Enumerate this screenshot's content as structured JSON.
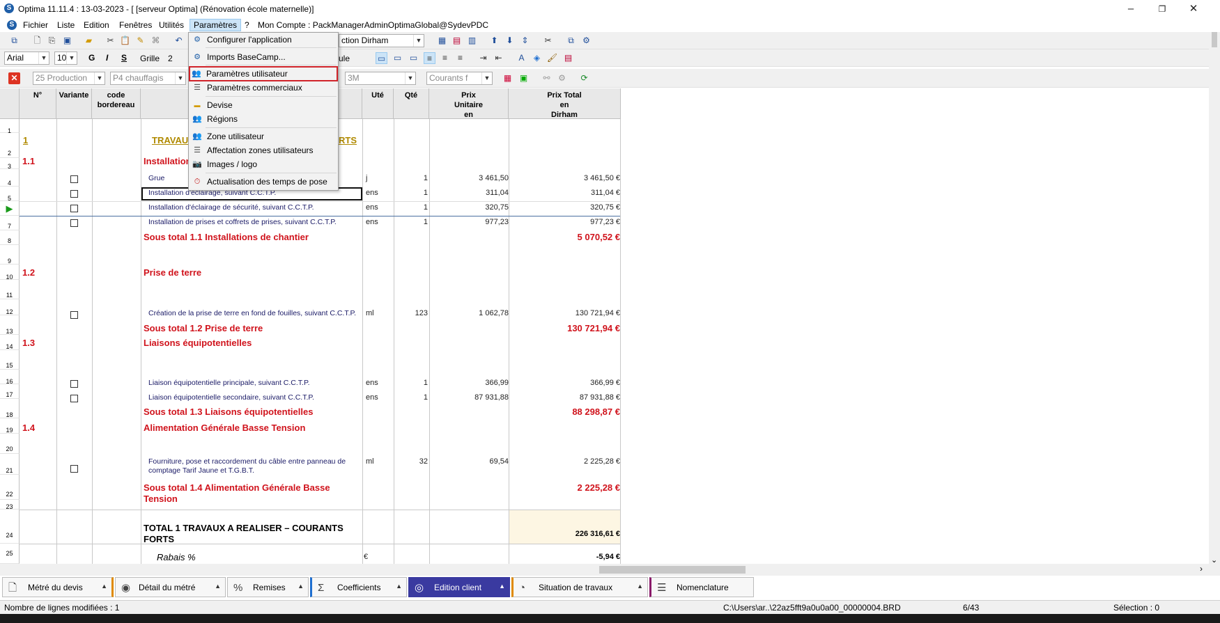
{
  "window": {
    "title": "Optima 11.11.4 : 13-03-2023 - [ [serveur Optima] (Rénovation école maternelle)]"
  },
  "menu": {
    "items": [
      "Fichier",
      "Liste",
      "Edition",
      "Fenêtres",
      "Utilités",
      "Paramètres",
      "?",
      "Mon Compte : PackManagerAdminOptimaGlobal@SydevPDC"
    ]
  },
  "toolbar": {
    "currency_combo": "ction Dirham",
    "font_name": "Arial",
    "font_size": "10",
    "bold": "G",
    "italic": "I",
    "underline": "S",
    "grid_label": "Grille",
    "grid_value": "2",
    "calc_label": "ule",
    "filter_production": "25 Production",
    "filter_p4": "P4 chauffagis",
    "filter_3m": "3M",
    "filter_courants": "Courants f"
  },
  "dropdown": {
    "items": [
      {
        "label": "Configurer l'application",
        "icon": "globe-gear-icon"
      },
      {
        "label": "Imports BaseCamp...",
        "icon": "globe-gear-icon"
      },
      {
        "label": "Paramètres utilisateur",
        "icon": "users-icon"
      },
      {
        "label": "Paramètres commerciaux",
        "icon": "list-icon"
      },
      {
        "label": "Devise",
        "icon": "currency-icon"
      },
      {
        "label": "Régions",
        "icon": "users-icon"
      },
      {
        "label": "Zone utilisateur",
        "icon": "users-icon"
      },
      {
        "label": "Affectation zones utilisateurs",
        "icon": "list-icon"
      },
      {
        "label": "Images / logo",
        "icon": "camera-icon"
      },
      {
        "label": "Actualisation des temps de pose",
        "icon": "clock-icon"
      }
    ],
    "highlighted": "Paramètres utilisateur"
  },
  "grid": {
    "headers": {
      "num": "N°",
      "variante": "Variante",
      "code": "code bordereau",
      "ute": "Uté",
      "qte": "Qté",
      "pu": "Prix Unitaire en Dirham",
      "pt": "Prix Total en Dirham"
    },
    "rows": {
      "r1": {
        "num": "1",
        "desc": "TRAVAU",
        "desc_tail": "RTS"
      },
      "r4": {
        "num": "1.1",
        "desc": "Installation"
      },
      "r5": {
        "desc": "Grue",
        "ute": "j",
        "qte": "1",
        "pu": "3 461,50",
        "pt": "3 461,50 €"
      },
      "r6": {
        "desc": "Installation d'éclairage, suivant C.C.T.P.",
        "ute": "ens",
        "qte": "1",
        "pu": "311,04",
        "pt": "311,04 €"
      },
      "r7": {
        "desc": "Installation d'éclairage de sécurité, suivant C.C.T.P.",
        "ute": "ens",
        "qte": "1",
        "pu": "320,75",
        "pt": "320,75 €"
      },
      "r8": {
        "desc": "Installation de prises et coffrets de prises, suivant C.C.T.P.",
        "ute": "ens",
        "qte": "1",
        "pu": "977,23",
        "pt": "977,23 €"
      },
      "r9": {
        "desc": "Sous total 1.1 Installations de chantier",
        "pt": "5 070,52 €"
      },
      "r11": {
        "num": "1.2",
        "desc": "Prise de terre"
      },
      "r12": {
        "desc": "Création de la prise de terre en fond de fouilles, suivant C.C.T.P.",
        "ute": "ml",
        "qte": "123",
        "pu": "1 062,78",
        "pt": "130 721,94 €"
      },
      "r13": {
        "desc": "Sous total 1.2 Prise de terre",
        "pt": "130 721,94 €"
      },
      "r15": {
        "num": "1.3",
        "desc": "Liaisons équipotentielles"
      },
      "r16": {
        "desc": "Liaison équipotentielle principale, suivant C.C.T.P.",
        "ute": "ens",
        "qte": "1",
        "pu": "366,99",
        "pt": "366,99 €"
      },
      "r17": {
        "desc": "Liaison équipotentielle secondaire, suivant C.C.T.P.",
        "ute": "ens",
        "qte": "1",
        "pu": "87 931,88",
        "pt": "87 931,88 €"
      },
      "r18": {
        "desc": "Sous total 1.3 Liaisons équipotentielles",
        "pt": "88 298,87 €"
      },
      "r20": {
        "num": "1.4",
        "desc": "Alimentation Générale Basse Tension"
      },
      "r21": {
        "desc1": "Fourniture, pose et raccordement du câble entre panneau de",
        "desc2": "comptage Tarif Jaune et T.G.B.T.",
        "ute": "ml",
        "qte": "32",
        "pu": "69,54",
        "pt": "2 225,28 €"
      },
      "r22": {
        "desc1": "Sous total 1.4 Alimentation Générale Basse",
        "desc2": "Tension",
        "pt": "2 225,28 €"
      },
      "r24": {
        "desc1": "TOTAL 1 TRAVAUX A REALISER – COURANTS",
        "desc2": "FORTS",
        "pt": "226 316,61 €"
      },
      "r25": {
        "desc": "Rabais %",
        "ute": "€",
        "pt": "-5,94 €"
      }
    }
  },
  "tabs": [
    {
      "label": "Métré du devis",
      "icon": "document-icon"
    },
    {
      "label": "Détail du métré",
      "icon": "eye-icon"
    },
    {
      "label": "Remises",
      "icon": "percent-icon"
    },
    {
      "label": "Coefficients",
      "icon": "sigma-icon"
    },
    {
      "label": "Edition client",
      "icon": "user-circle-icon"
    },
    {
      "label": "Situation de travaux",
      "icon": "clock-icon"
    },
    {
      "label": "Nomenclature",
      "icon": "list-icon"
    }
  ],
  "status": {
    "modified": "Nombre de lignes modifiées : 1",
    "path": "C:\\Users\\ar..\\22az5fft9a0u0a00_00000004.BRD",
    "page": "6/43",
    "selection": "Sélection : 0"
  },
  "colors": {
    "accent_red": "#d0131c",
    "active_tab": "#3a3aa0",
    "highlight": "#d1232a"
  }
}
